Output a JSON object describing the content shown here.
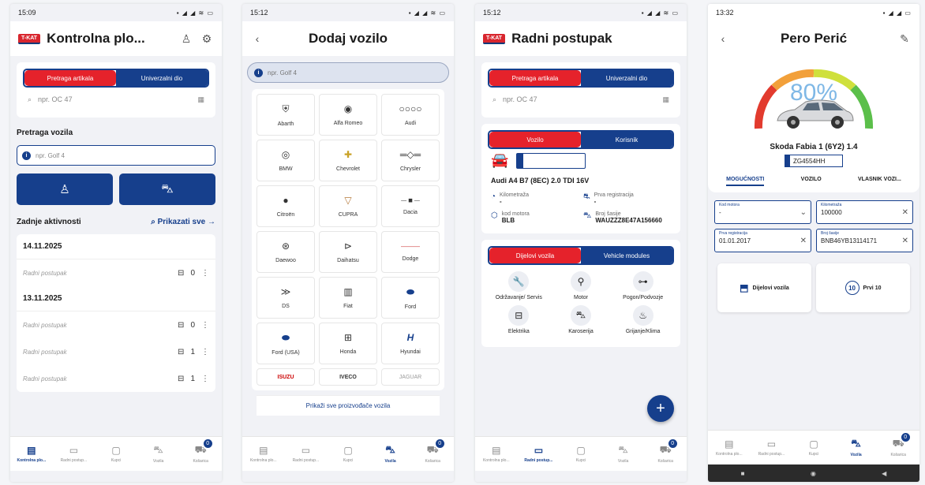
{
  "common": {
    "logo": "T-KAT",
    "nav": [
      "Kontrolna plo...",
      "Radni postup...",
      "Kupci",
      "Vozila",
      "Košarica"
    ],
    "cart_count": "0",
    "search_article_tab": "Pretraga artikala",
    "universal_tab": "Univerzalni dio",
    "article_placeholder": "npr. OC 47",
    "vehicle_placeholder": "npr. Golf 4"
  },
  "phone1": {
    "time": "15:09",
    "title": "Kontrolna plo...",
    "vehicle_search": "Pretraga vozila",
    "recent": "Zadnje aktivnosti",
    "show_all": "Prikazati sve",
    "groups": [
      {
        "date": "14.11.2025",
        "rows": [
          {
            "label": "Radni postupak",
            "count": "0"
          }
        ]
      },
      {
        "date": "13.11.2025",
        "rows": [
          {
            "label": "Radni postupak",
            "count": "0"
          },
          {
            "label": "Radni postupak",
            "count": "1"
          },
          {
            "label": "Radni postupak",
            "count": "1"
          }
        ]
      }
    ]
  },
  "phone2": {
    "time": "15:12",
    "title": "Dodaj vozilo",
    "brands": [
      "Abarth",
      "Alfa Romeo",
      "Audi",
      "BMW",
      "Chevrolet",
      "Chrysler",
      "Citroën",
      "CUPRA",
      "Dacia",
      "Daewoo",
      "Daihatsu",
      "Dodge",
      "DS",
      "Fiat",
      "Ford",
      "Ford (USA)",
      "Honda",
      "Hyundai"
    ],
    "cut_brands": [
      "ISUZU",
      "IVECO",
      "JAGUAR"
    ],
    "show_all_makers": "Prikaži sve proizvođače vozila"
  },
  "phone3": {
    "time": "15:12",
    "title": "Radni postupak",
    "tab_vehicle": "Vozilo",
    "tab_user": "Korisnik",
    "car_name": "Audi A4 B7 (8EC) 2.0 TDI 16V",
    "specs": [
      {
        "label": "Kilometraža",
        "value": "-"
      },
      {
        "label": "Prva registracija",
        "value": "-"
      },
      {
        "label": "kod motora",
        "value": "BLB"
      },
      {
        "label": "Broj šasije",
        "value": "WAUZZZ8E47A156660"
      }
    ],
    "tab_parts": "Dijelovi vozila",
    "tab_modules": "Vehicle modules",
    "modules": [
      "Održavanje/ Servis",
      "Motor",
      "Pogon/Podvozje",
      "Elektrika",
      "Karoserija",
      "Grijanje/Klima"
    ]
  },
  "phone4": {
    "time": "13:32",
    "title": "Pero Perić",
    "percent": "80%",
    "percent_value": 80,
    "model": "Skoda Fabia 1 (6Y2) 1.4",
    "plate": "ZG4554HH",
    "tabs": [
      "MOGUĆNOSTI",
      "VOZILO",
      "VLASNIK VOZI..."
    ],
    "fields": [
      {
        "label": "Kod motora",
        "value": "-"
      },
      {
        "label": "Kilometraža",
        "value": "100000"
      },
      {
        "label": "Prva registracija",
        "value": "01.01.2017"
      },
      {
        "label": "Broj šasije",
        "value": "BNB46YB13114171"
      }
    ],
    "tile_parts": "Dijelovi vozila",
    "tile_top": "Prvi 10",
    "tile_top_num": "10"
  }
}
